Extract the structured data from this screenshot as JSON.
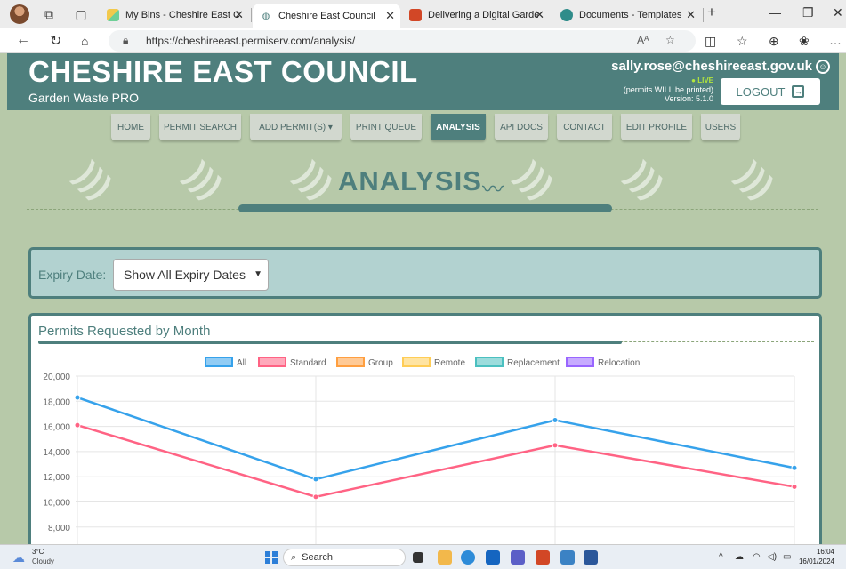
{
  "browser": {
    "tabs": [
      {
        "title": "My Bins - Cheshire East Co",
        "active": false
      },
      {
        "title": "Cheshire East Council",
        "active": true
      },
      {
        "title": "Delivering a Digital Garde",
        "active": false
      },
      {
        "title": "Documents - Templates",
        "active": false
      }
    ],
    "new_tab": "+",
    "url": "https://cheshireeast.permiserv.com/analysis/"
  },
  "header": {
    "title": "CHESHIRE EAST COUNCIL",
    "subtitle": "Garden Waste PRO",
    "user_email": "sally.rose@cheshireeast.gov.uk",
    "live": "LIVE",
    "permit_note": "(permits WILL be printed)",
    "version": "Version: 5.1.0",
    "logout": "LOGOUT"
  },
  "nav": {
    "items": [
      {
        "label": "HOME",
        "active": false
      },
      {
        "label": "PERMIT SEARCH",
        "active": false
      },
      {
        "label": "ADD PERMIT(S) ▾",
        "active": false
      },
      {
        "label": "PRINT QUEUE",
        "active": false
      },
      {
        "label": "ANALYSIS",
        "active": true
      },
      {
        "label": "API DOCS",
        "active": false
      },
      {
        "label": "CONTACT",
        "active": false
      },
      {
        "label": "EDIT PROFILE",
        "active": false
      },
      {
        "label": "USERS",
        "active": false
      }
    ]
  },
  "hero": {
    "title": "ANALYSIS",
    "icon": "trend-icon"
  },
  "filter": {
    "label": "Expiry Date:",
    "selected": "Show All Expiry Dates"
  },
  "panel": {
    "title": "Permits Requested by Month"
  },
  "chart_data": {
    "type": "line",
    "title": "Permits Requested by Month",
    "x": [
      "1",
      "2",
      "3",
      "4"
    ],
    "ylim": [
      8000,
      20000
    ],
    "y_ticks": [
      "20,000",
      "18,000",
      "16,000",
      "14,000",
      "12,000",
      "10,000",
      "8,000"
    ],
    "legend_position": "top",
    "grid": true,
    "series": [
      {
        "name": "All",
        "color": "#36a2eb",
        "values": [
          18300,
          11800,
          16500,
          12700
        ]
      },
      {
        "name": "Standard",
        "color": "#ff6384",
        "values": [
          16100,
          10400,
          14500,
          11200
        ]
      },
      {
        "name": "Group",
        "color": "#ff9f40",
        "values": []
      },
      {
        "name": "Remote",
        "color": "#ffcd56",
        "values": []
      },
      {
        "name": "Replacement",
        "color": "#4bc0c0",
        "values": []
      },
      {
        "name": "Relocation",
        "color": "#9966ff",
        "values": []
      }
    ]
  },
  "taskbar": {
    "weather_temp": "3°C",
    "weather_cond": "Cloudy",
    "search": "Search",
    "time": "16:04",
    "date": "16/01/2024"
  },
  "colors": {
    "brand": "#4e7f7d",
    "page_bg": "#b7c9a9",
    "filter_bg": "#b2d2d0",
    "live": "#b3e63d"
  }
}
